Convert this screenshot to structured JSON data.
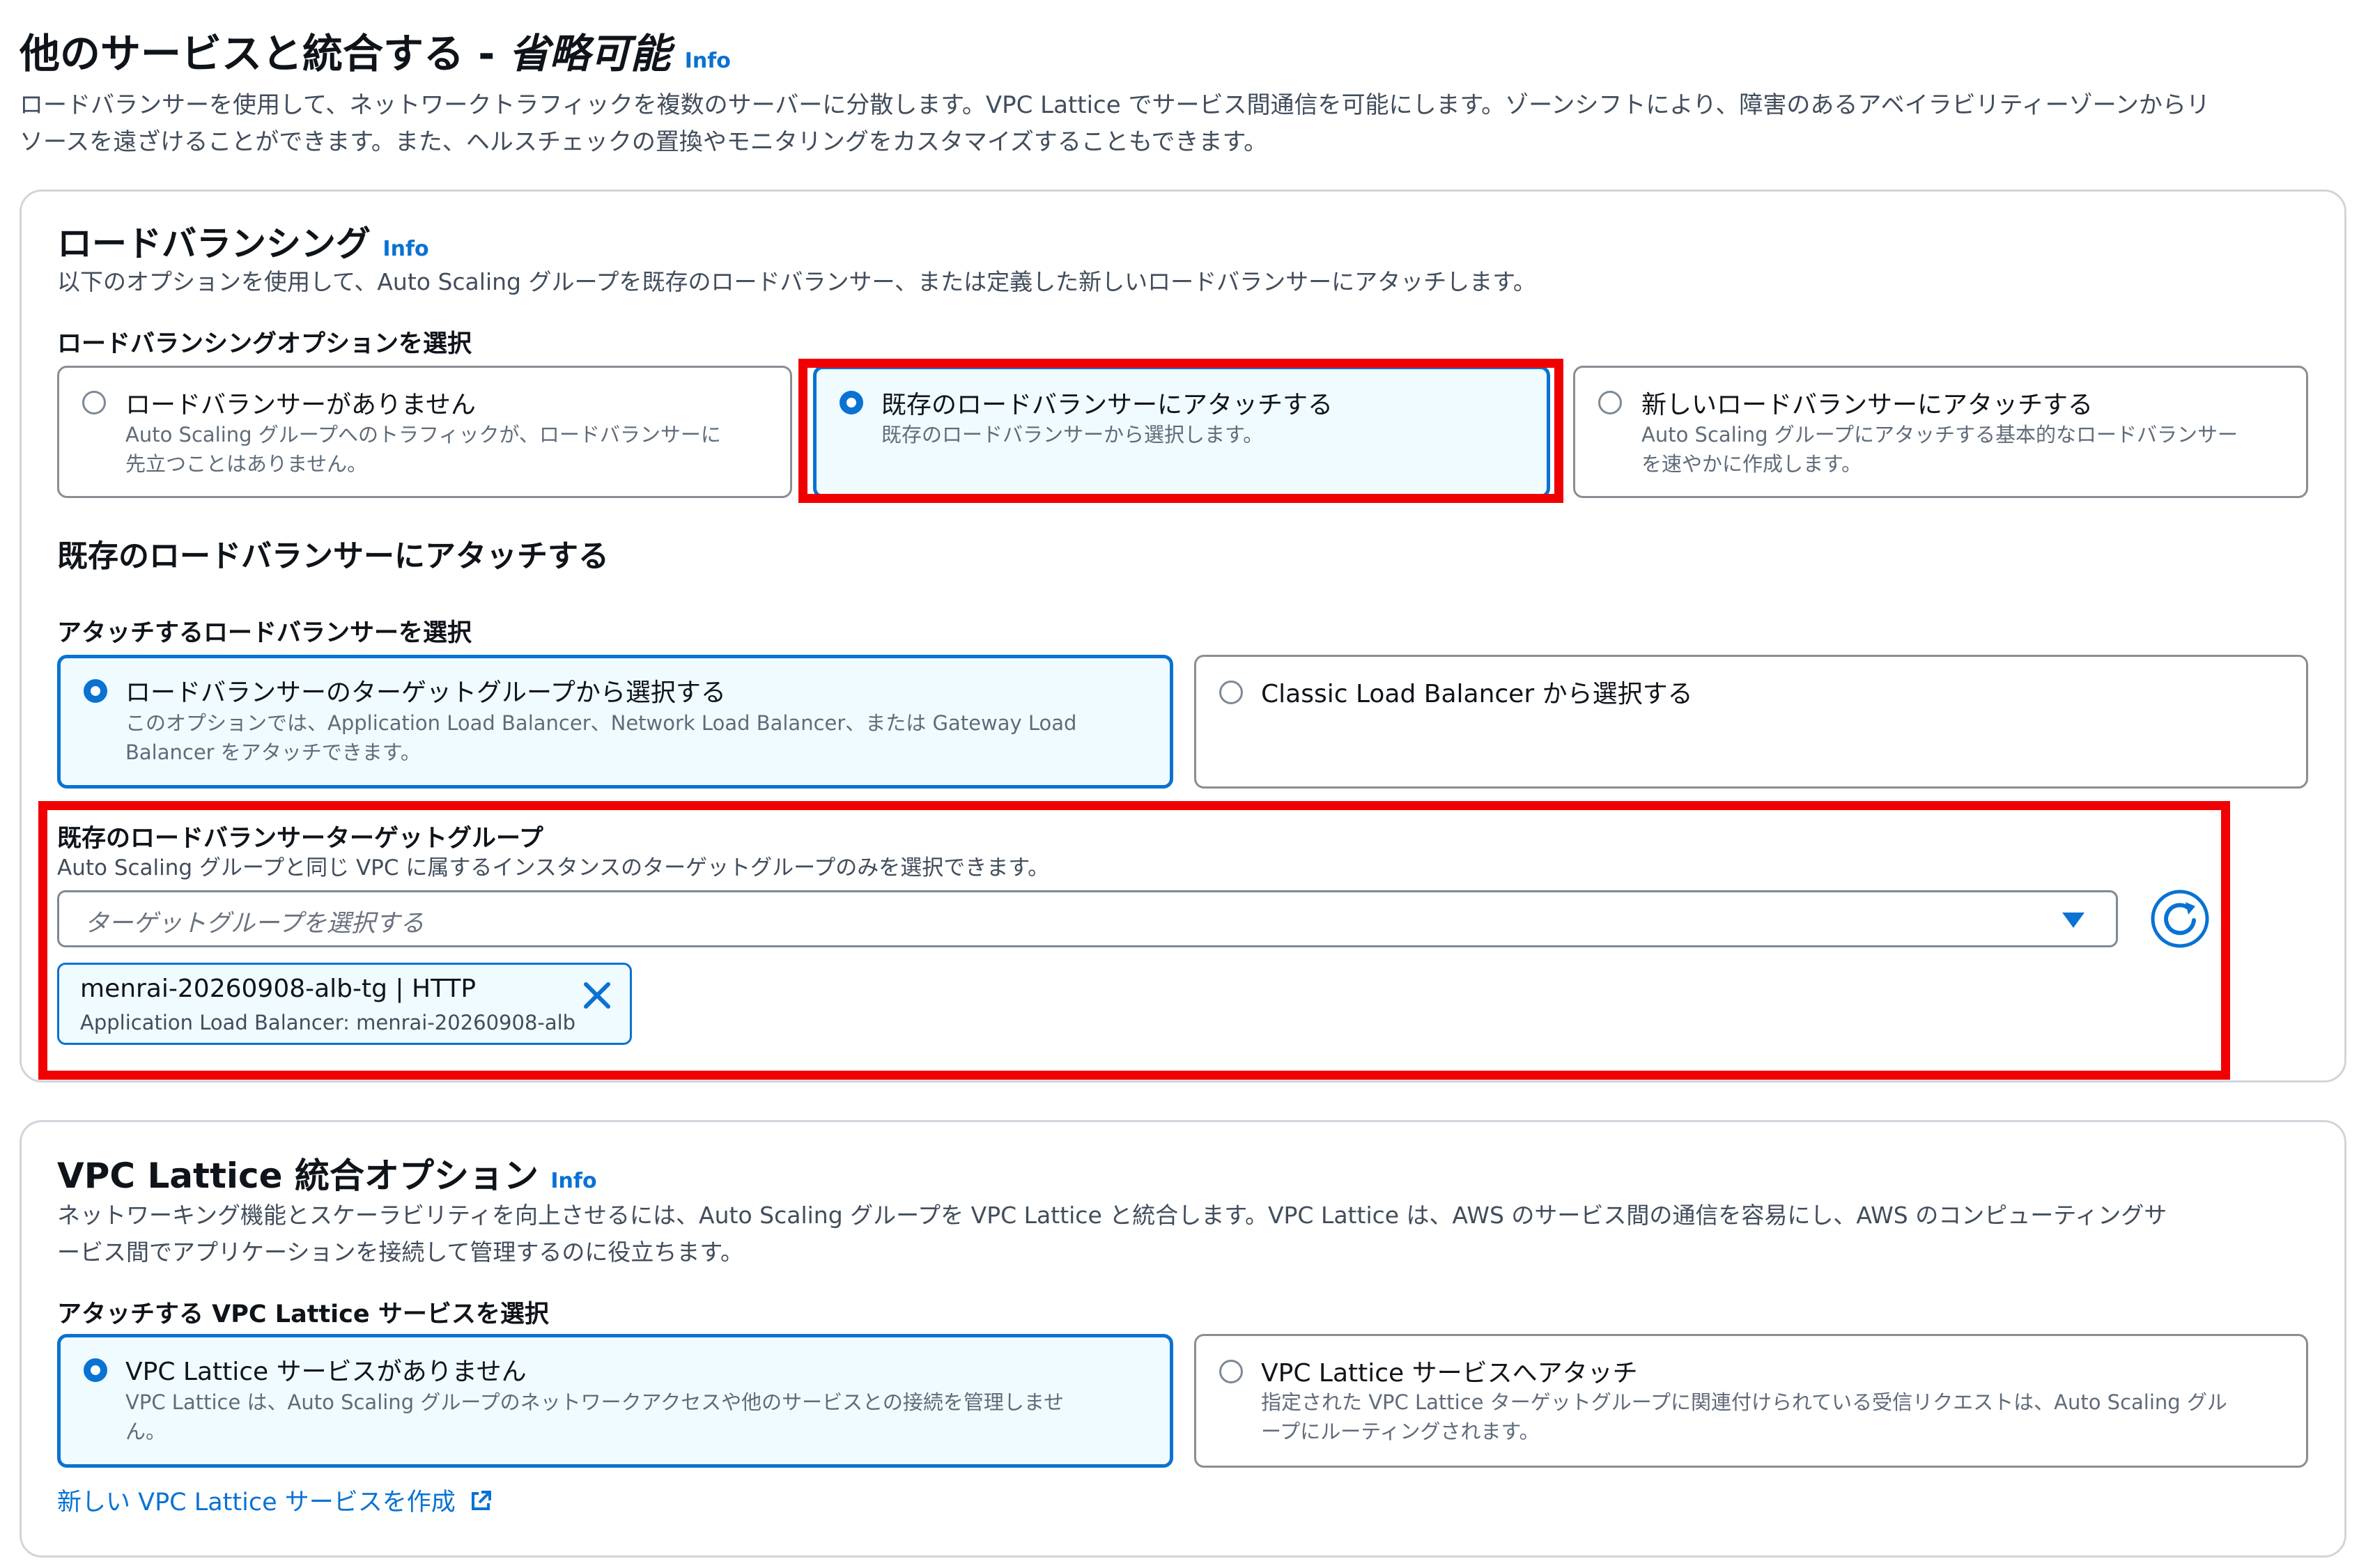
{
  "page": {
    "title": "他のサービスと統合する -",
    "title_optional": "省略可能",
    "info": "Info",
    "description_line1": "ロードバランサーを使用して、ネットワークトラフィックを複数のサーバーに分散します。VPC Lattice でサービス間通信を可能にします。ゾーンシフトにより、障害のあるアベイラビリティーゾーンからリ",
    "description_line2": "ソースを遠ざけることができます。また、ヘルスチェックの置換やモニタリングをカスタマイズすることもできます。"
  },
  "load_balancing": {
    "heading": "ロードバランシング",
    "info": "Info",
    "description": "以下のオプションを使用して、Auto Scaling グループを既存のロードバランサー、または定義した新しいロードバランサーにアタッチします。",
    "options_label": "ロードバランシングオプションを選択",
    "options": [
      {
        "title": "ロードバランサーがありません",
        "desc1": "Auto Scaling グループへのトラフィックが、ロードバランサーに",
        "desc2": "先立つことはありません。",
        "selected": false
      },
      {
        "title": "既存のロードバランサーにアタッチする",
        "desc1": "既存のロードバランサーから選択します。",
        "desc2": "",
        "selected": true
      },
      {
        "title": "新しいロードバランサーにアタッチする",
        "desc1": "Auto Scaling グループにアタッチする基本的なロードバランサー",
        "desc2": "を速やかに作成します。",
        "selected": false
      }
    ],
    "attach_heading": "既存のロードバランサーにアタッチする",
    "attach_label": "アタッチするロードバランサーを選択",
    "attach_options": [
      {
        "title": "ロードバランサーのターゲットグループから選択する",
        "desc1": "このオプションでは、Application Load Balancer、Network Load Balancer、または Gateway Load",
        "desc2": "Balancer をアタッチできます。",
        "selected": true
      },
      {
        "title": "Classic Load Balancer から選択する",
        "desc1": "",
        "desc2": "",
        "selected": false
      }
    ],
    "target_group_label": "既存のロードバランサーターゲットグループ",
    "target_group_desc": "Auto Scaling グループと同じ VPC に属するインスタンスのターゲットグループのみを選択できます。",
    "target_group_placeholder": "ターゲットグループを選択する",
    "selected_group": {
      "name": "menrai-20260908-alb-tg | HTTP",
      "detail": "Application Load Balancer: menrai-20260908-alb"
    }
  },
  "vpc_lattice": {
    "heading": "VPC Lattice 統合オプション",
    "info": "Info",
    "description_line1": "ネットワーキング機能とスケーラビリティを向上させるには、Auto Scaling グループを VPC Lattice と統合します。VPC Lattice は、AWS のサービス間の通信を容易にし、AWS のコンピューティングサ",
    "description_line2": "ービス間でアプリケーションを接続して管理するのに役立ちます。",
    "options_label": "アタッチする VPC Lattice サービスを選択",
    "options": [
      {
        "title": "VPC Lattice サービスがありません",
        "desc1": "VPC Lattice は、Auto Scaling グループのネットワークアクセスや他のサービスとの接続を管理しませ",
        "desc2": "ん。",
        "selected": true
      },
      {
        "title": "VPC Lattice サービスへアタッチ",
        "desc1": "指定された VPC Lattice ターゲットグループに関連付けられている受信リクエストは、Auto Scaling グル",
        "desc2": "ープにルーティングされます。",
        "selected": false
      }
    ],
    "create_link": "新しい VPC Lattice サービスを作成"
  },
  "colors": {
    "accent": "#0972d3",
    "highlight_box": "#f00000",
    "selected_tile_bg": "#f0fbff"
  },
  "icons": [
    "refresh-icon",
    "dropdown-caret-icon",
    "close-icon",
    "external-link-icon"
  ]
}
